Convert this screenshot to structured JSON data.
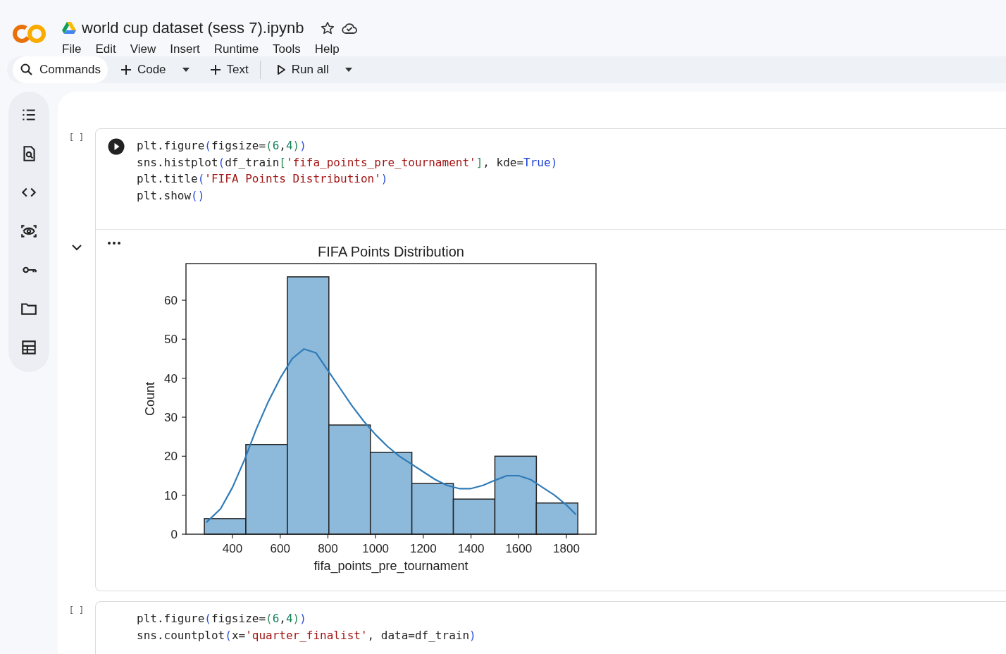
{
  "notebook": {
    "title": "world cup dataset (sess 7).ipynb",
    "starred": false
  },
  "menu": [
    "File",
    "Edit",
    "View",
    "Insert",
    "Runtime",
    "Tools",
    "Help"
  ],
  "toolbar": {
    "commands": "Commands",
    "add_code": "Code",
    "add_text": "Text",
    "run_all": "Run all"
  },
  "sidebar": {
    "items": [
      {
        "kind": "toc"
      },
      {
        "kind": "find"
      },
      {
        "kind": "snippets"
      },
      {
        "kind": "variables"
      },
      {
        "kind": "secrets"
      },
      {
        "kind": "files"
      },
      {
        "kind": "data"
      }
    ]
  },
  "cells": [
    {
      "exec_count": "[ ]",
      "expanded": true,
      "lines": [
        [
          {
            "kind": "plain",
            "text": "plt.figure"
          },
          {
            "kind": "paren",
            "text": "("
          },
          {
            "kind": "plain",
            "text": "figsize="
          },
          {
            "kind": "paren2",
            "text": "("
          },
          {
            "kind": "number",
            "text": "6"
          },
          {
            "kind": "plain",
            "text": ","
          },
          {
            "kind": "number",
            "text": "4"
          },
          {
            "kind": "paren2",
            "text": ")"
          },
          {
            "kind": "paren",
            "text": ")"
          }
        ],
        [
          {
            "kind": "plain",
            "text": "sns.histplot"
          },
          {
            "kind": "paren",
            "text": "("
          },
          {
            "kind": "plain",
            "text": "df_train"
          },
          {
            "kind": "paren2",
            "text": "["
          },
          {
            "kind": "string",
            "text": "'fifa_points_pre_tournament'"
          },
          {
            "kind": "paren2",
            "text": "]"
          },
          {
            "kind": "plain",
            "text": ", kde="
          },
          {
            "kind": "keyword",
            "text": "True"
          },
          {
            "kind": "paren",
            "text": ")"
          }
        ],
        [
          {
            "kind": "plain",
            "text": "plt.title"
          },
          {
            "kind": "paren",
            "text": "("
          },
          {
            "kind": "string",
            "text": "'FIFA Points Distribution'"
          },
          {
            "kind": "paren",
            "text": ")"
          }
        ],
        [
          {
            "kind": "plain",
            "text": "plt.show"
          },
          {
            "kind": "paren",
            "text": "()"
          }
        ]
      ],
      "output": {
        "chart_data": {
          "type": "bar",
          "title": "FIFA Points Distribution",
          "xlabel": "fifa_points_pre_tournament",
          "ylabel": "Count",
          "x": [
            369,
            543,
            717,
            891,
            1065,
            1239,
            1413,
            1587,
            1761
          ],
          "series": [
            {
              "type": "bar",
              "color": "#8db9da",
              "values": [
                4,
                23,
                66,
                28,
                21,
                13,
                9,
                20,
                8
              ]
            },
            {
              "type": "line",
              "color": "#2f7bb8",
              "x": [
                290,
                350,
                400,
                450,
                500,
                550,
                600,
                650,
                700,
                750,
                800,
                850,
                900,
                950,
                1000,
                1050,
                1100,
                1150,
                1200,
                1250,
                1300,
                1350,
                1400,
                1450,
                1500,
                1550,
                1600,
                1650,
                1700,
                1750,
                1800,
                1840
              ],
              "values": [
                3,
                6.5,
                12,
                19,
                27,
                34,
                40,
                45,
                47.5,
                46.5,
                42,
                37.5,
                33,
                29,
                25.5,
                22.5,
                20,
                18,
                16,
                14,
                12.5,
                11.7,
                11.7,
                12.5,
                13.8,
                15,
                15,
                14,
                12,
                10,
                7.5,
                5
              ]
            }
          ],
          "xlim": [
            205,
            1924
          ],
          "ylim": [
            0,
            69.4
          ],
          "xticks": [
            400,
            600,
            800,
            1000,
            1200,
            1400,
            1600,
            1800
          ],
          "yticks": [
            0,
            10,
            20,
            30,
            40,
            50,
            60
          ]
        }
      }
    },
    {
      "exec_count": "[ ]",
      "lines": [
        [
          {
            "kind": "plain",
            "text": "plt.figure"
          },
          {
            "kind": "paren",
            "text": "("
          },
          {
            "kind": "plain",
            "text": "figsize="
          },
          {
            "kind": "paren2",
            "text": "("
          },
          {
            "kind": "number",
            "text": "6"
          },
          {
            "kind": "plain",
            "text": ","
          },
          {
            "kind": "number",
            "text": "4"
          },
          {
            "kind": "paren2",
            "text": ")"
          },
          {
            "kind": "paren",
            "text": ")"
          }
        ],
        [
          {
            "kind": "plain",
            "text": "sns.countplot"
          },
          {
            "kind": "paren",
            "text": "("
          },
          {
            "kind": "plain",
            "text": "x="
          },
          {
            "kind": "string",
            "text": "'quarter_finalist'"
          },
          {
            "kind": "plain",
            "text": ", data=df_train"
          },
          {
            "kind": "paren",
            "text": ")"
          }
        ]
      ]
    }
  ]
}
